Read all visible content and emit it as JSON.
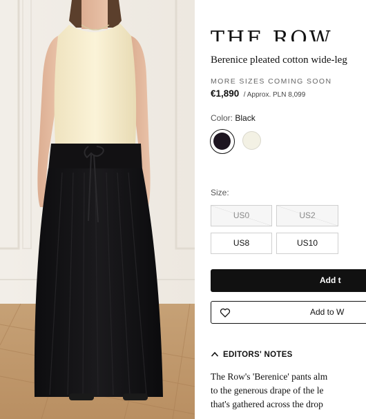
{
  "product": {
    "brand": "THE ROW",
    "name": "Berenice pleated cotton wide-leg",
    "sizes_note": "MORE SIZES COMING SOON",
    "price": "€1,890",
    "price_approx": "/ Approx. PLN 8,099"
  },
  "color": {
    "label": "Color:",
    "selected": "Black",
    "swatches": [
      {
        "name": "Black",
        "hex": "#1d1520",
        "selected": true
      },
      {
        "name": "Cream",
        "hex": "#f3f1e4",
        "selected": false
      }
    ]
  },
  "size": {
    "label": "Size:",
    "options": [
      {
        "label": "US0",
        "available": false
      },
      {
        "label": "US2",
        "available": false
      },
      {
        "label": "US8",
        "available": true
      },
      {
        "label": "US10",
        "available": true
      }
    ]
  },
  "actions": {
    "add_to_bag": "Add t",
    "add_to_wishlist": "Add to W"
  },
  "editors_notes": {
    "heading": "EDITORS' NOTES",
    "lines": [
      "The Row's 'Berenice' pants alm",
      "to the generous drape of the le",
      "that's gathered across the drop"
    ]
  }
}
